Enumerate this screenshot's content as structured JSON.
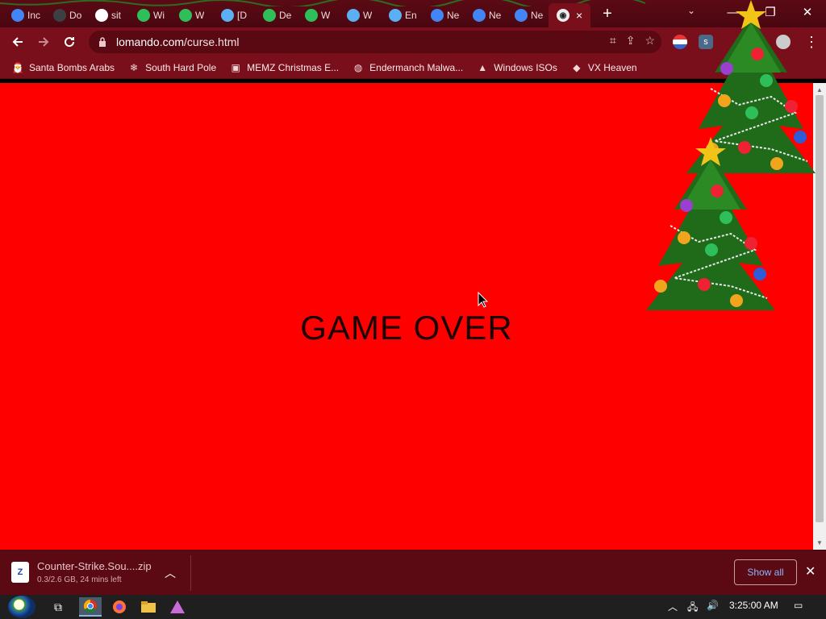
{
  "colors": {
    "page_background": "#ff0000",
    "frame": "#7a0f1c",
    "tabstrip": "#5b0a14",
    "show_all_text": "#8ab4f8"
  },
  "tabs": [
    {
      "label": "Inc",
      "icon": "chrome-icon"
    },
    {
      "label": "Do",
      "icon": "download-icon"
    },
    {
      "label": "sit",
      "icon": "google-icon"
    },
    {
      "label": "Wi",
      "icon": "leaf-icon"
    },
    {
      "label": "W",
      "icon": "leaf-icon"
    },
    {
      "label": "[D",
      "icon": "cloud-icon"
    },
    {
      "label": "De",
      "icon": "leaf-icon"
    },
    {
      "label": "W",
      "icon": "leaf-icon"
    },
    {
      "label": "W",
      "icon": "cloud-icon"
    },
    {
      "label": "En",
      "icon": "cloud-icon"
    },
    {
      "label": "Ne",
      "icon": "chrome-icon"
    },
    {
      "label": "Ne",
      "icon": "chrome-icon"
    },
    {
      "label": "Ne",
      "icon": "chrome-icon"
    }
  ],
  "active_tab": {
    "icon": "panda-icon",
    "close": "×"
  },
  "new_tab_label": "+",
  "window_controls": {
    "minimize": "—",
    "restore": "❐",
    "close": "✕"
  },
  "address": {
    "host": "lomando.com",
    "path": "/curse.html"
  },
  "bookmarks": [
    {
      "label": "Santa Bombs Arabs",
      "icon": "santa-icon"
    },
    {
      "label": "South Hard Pole",
      "icon": "snowflake-icon"
    },
    {
      "label": "MEMZ Christmas E...",
      "icon": "image-icon"
    },
    {
      "label": "Endermanch Malwa...",
      "icon": "raccoon-icon"
    },
    {
      "label": "Windows ISOs",
      "icon": "tree-icon"
    },
    {
      "label": "VX Heaven",
      "icon": "vx-icon"
    }
  ],
  "page": {
    "message": "GAME OVER"
  },
  "download": {
    "filename": "Counter-Strike.Sou....zip",
    "status": "0.3/2.6 GB, 24 mins left",
    "show_all": "Show all"
  },
  "taskbar": {
    "time": "3:25:00 AM"
  }
}
